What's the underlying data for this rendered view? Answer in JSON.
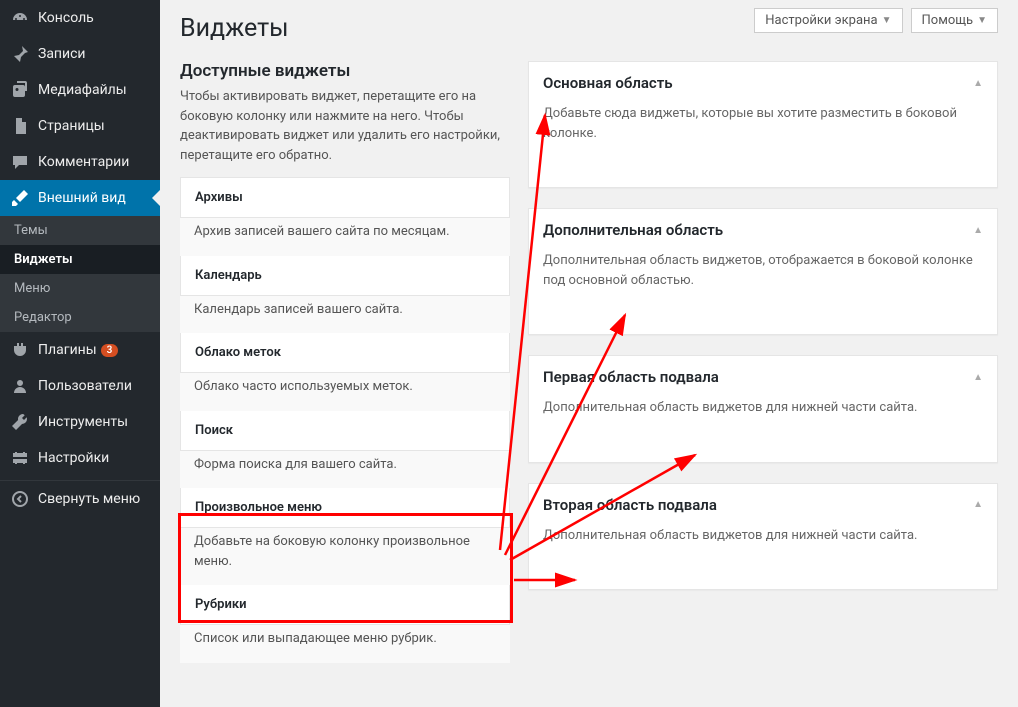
{
  "top": {
    "screen_options": "Настройки экрана",
    "help": "Помощь"
  },
  "page_title": "Виджеты",
  "sidebar": {
    "items": [
      {
        "label": "Консоль",
        "icon": "dashboard"
      },
      {
        "label": "Записи",
        "icon": "pin"
      },
      {
        "label": "Медиафайлы",
        "icon": "media"
      },
      {
        "label": "Страницы",
        "icon": "pages"
      },
      {
        "label": "Комментарии",
        "icon": "comments"
      },
      {
        "label": "Внешний вид",
        "icon": "brush",
        "active": true
      },
      {
        "label": "Плагины",
        "icon": "plugin",
        "badge": "3"
      },
      {
        "label": "Пользователи",
        "icon": "users"
      },
      {
        "label": "Инструменты",
        "icon": "tools"
      },
      {
        "label": "Настройки",
        "icon": "settings"
      }
    ],
    "subitems": [
      {
        "label": "Темы"
      },
      {
        "label": "Виджеты",
        "current": true
      },
      {
        "label": "Меню"
      },
      {
        "label": "Редактор"
      }
    ],
    "collapse": "Свернуть меню"
  },
  "available": {
    "title": "Доступные виджеты",
    "desc": "Чтобы активировать виджет, перетащите его на боковую колонку или нажмите на него. Чтобы деактивировать виджет или удалить его настройки, перетащите его обратно.",
    "widgets": [
      {
        "title": "Архивы",
        "desc": "Архив записей вашего сайта по месяцам."
      },
      {
        "title": "Календарь",
        "desc": "Календарь записей вашего сайта."
      },
      {
        "title": "Облако меток",
        "desc": "Облако часто используемых меток."
      },
      {
        "title": "Поиск",
        "desc": "Форма поиска для вашего сайта."
      },
      {
        "title": "Произвольное меню",
        "desc": "Добавьте на боковую колонку произвольное меню."
      },
      {
        "title": "Рубрики",
        "desc": "Список или выпадающее меню рубрик."
      }
    ]
  },
  "areas": [
    {
      "title": "Основная область",
      "desc": "Добавьте сюда виджеты, которые вы хотите разместить в боковой колонке."
    },
    {
      "title": "Дополнительная область",
      "desc": "Дополнительная область виджетов, отображается в боковой колонке под основной областью."
    },
    {
      "title": "Первая область подвала",
      "desc": "Дополнительная область виджетов для нижней части сайта."
    },
    {
      "title": "Вторая область подвала",
      "desc": "Дополнительная область виджетов для нижней части сайта."
    }
  ]
}
